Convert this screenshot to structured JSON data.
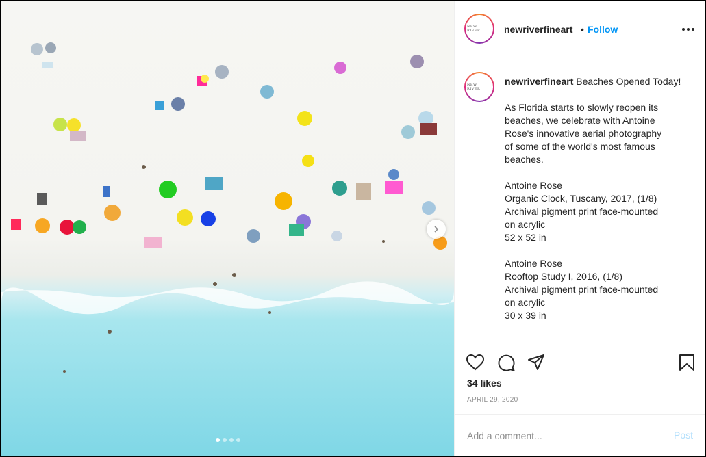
{
  "post": {
    "author": "newriverfineart",
    "avatar_text": "NEW RIVER",
    "separator": "•",
    "follow_label": "Follow",
    "caption_title": "Beaches Opened Today!",
    "caption_intro": [
      "As Florida starts to slowly reopen its",
      "beaches, we celebrate with Antoine",
      "Rose's innovative aerial photography",
      "of some of the world's most famous",
      "beaches."
    ],
    "artwork_1": [
      "Antoine Rose",
      "Organic Clock, Tuscany, 2017, (1/8)",
      "Archival pigment print face-mounted",
      "on acrylic",
      "52 x 52 in"
    ],
    "artwork_2": [
      "Antoine Rose",
      "Rooftop Study I, 2016, (1/8)",
      "Archival pigment print face-mounted",
      "on acrylic",
      "30 x 39 in"
    ],
    "likes": "34 likes",
    "date": "APRIL 29, 2020"
  },
  "comment": {
    "placeholder": "Add a comment...",
    "post_label": "Post"
  },
  "carousel": {
    "slides": 4,
    "current": 1
  },
  "icons": {
    "next": "chevron-right-icon",
    "more": "more-options-icon",
    "like": "heart-icon",
    "comment": "comment-icon",
    "share": "share-icon",
    "save": "bookmark-icon"
  },
  "colors": {
    "follow": "#0095f6",
    "post_disabled": "#b2dffc",
    "sand": "#f7f7f4",
    "water": "#8edcea"
  }
}
